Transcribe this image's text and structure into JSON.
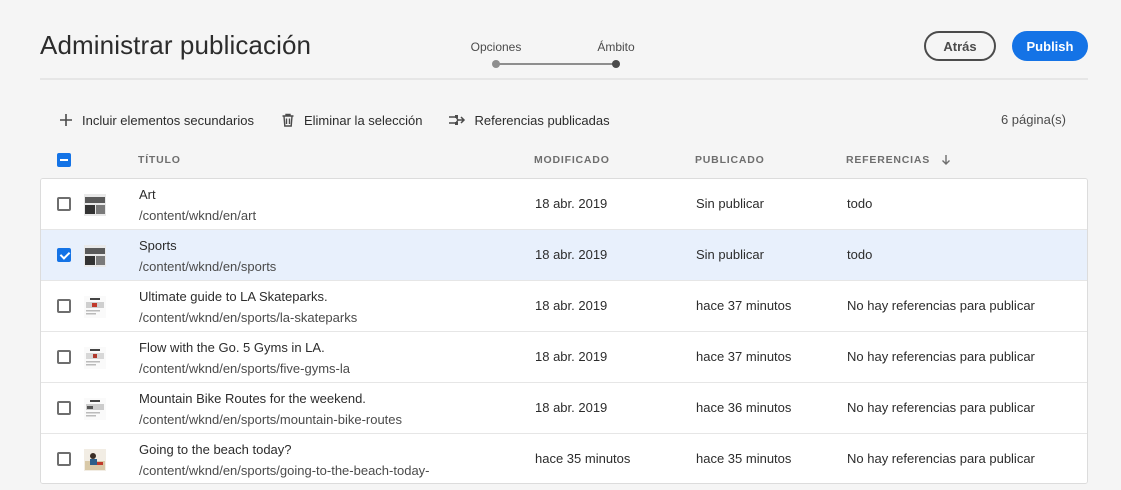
{
  "header": {
    "title": "Administrar publicación",
    "wizard": {
      "steps": [
        "Opciones",
        "Ámbito"
      ],
      "active_step": 2
    },
    "back_label": "Atrás",
    "publish_label": "Publish"
  },
  "toolbar": {
    "include_children": "Incluir elementos secundarios",
    "remove_selection": "Eliminar la selección",
    "published_references": "Referencias publicadas",
    "count": "6 página(s)"
  },
  "table": {
    "columns": {
      "title": "TÍTULO",
      "modified": "MODIFICADO",
      "published": "PUBLICADO",
      "references": "REFERENCIAS"
    },
    "rows": [
      {
        "title": "Art",
        "path": "/content/wknd/en/art",
        "modified": "18 abr. 2019",
        "published": "Sin publicar",
        "references": "todo",
        "selected": false,
        "thumb": "dark"
      },
      {
        "title": "Sports",
        "path": "/content/wknd/en/sports",
        "modified": "18 abr. 2019",
        "published": "Sin publicar",
        "references": "todo",
        "selected": true,
        "thumb": "dark"
      },
      {
        "title": "Ultimate guide to LA Skateparks.",
        "path": "/content/wknd/en/sports/la-skateparks",
        "modified": "18 abr. 2019",
        "published": "hace 37 minutos",
        "references": "No hay referencias para publicar",
        "selected": false,
        "thumb": "light"
      },
      {
        "title": "Flow with the Go. 5 Gyms in LA.",
        "path": "/content/wknd/en/sports/five-gyms-la",
        "modified": "18 abr. 2019",
        "published": "hace 37 minutos",
        "references": "No hay referencias para publicar",
        "selected": false,
        "thumb": "light"
      },
      {
        "title": "Mountain Bike Routes for the weekend.",
        "path": "/content/wknd/en/sports/mountain-bike-routes",
        "modified": "18 abr. 2019",
        "published": "hace 36 minutos",
        "references": "No hay referencias para publicar",
        "selected": false,
        "thumb": "light"
      },
      {
        "title": "Going to the beach today?",
        "path": "/content/wknd/en/sports/going-to-the-beach-today-",
        "modified": "hace 35 minutos",
        "published": "hace 35 minutos",
        "references": "No hay referencias para publicar",
        "selected": false,
        "thumb": "photo"
      }
    ]
  },
  "colors": {
    "accent": "#1473e6",
    "selected_row": "#e8f0fc"
  }
}
